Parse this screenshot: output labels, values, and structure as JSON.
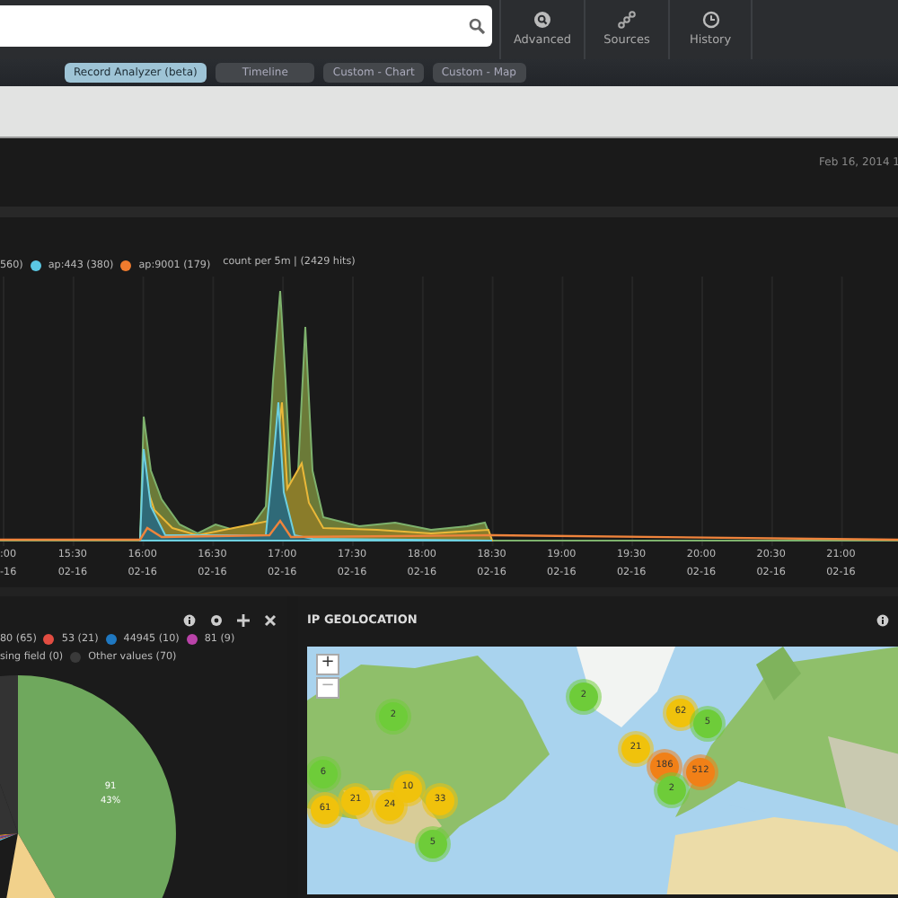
{
  "nav_buttons": [
    {
      "label": "Advanced",
      "kind": "search"
    },
    {
      "label": "Sources",
      "kind": "nodes"
    },
    {
      "label": "History",
      "kind": "clock"
    }
  ],
  "tabs": [
    {
      "label": "Record Analyzer (beta)",
      "selected": true
    },
    {
      "label": "Timeline",
      "selected": false
    },
    {
      "label": "Custom - Chart",
      "selected": false
    },
    {
      "label": "Custom - Map",
      "selected": false
    }
  ],
  "header": {
    "date": "Feb 16, 2014 1"
  },
  "histogram": {
    "legend": [
      {
        "label": "560)"
      },
      {
        "label": "ap:443 (380)",
        "color": "#5bc8e4"
      },
      {
        "label": "ap:9001 (179)",
        "color": "#ef7b2e"
      }
    ],
    "summary": "count per 5m | (2429 hits)",
    "x_labels": [
      {
        "time": ":00",
        "date": "-16"
      },
      {
        "time": "15:30",
        "date": "02-16"
      },
      {
        "time": "16:00",
        "date": "02-16"
      },
      {
        "time": "16:30",
        "date": "02-16"
      },
      {
        "time": "17:00",
        "date": "02-16"
      },
      {
        "time": "17:30",
        "date": "02-16"
      },
      {
        "time": "18:00",
        "date": "02-16"
      },
      {
        "time": "18:30",
        "date": "02-16"
      },
      {
        "time": "19:00",
        "date": "02-16"
      },
      {
        "time": "19:30",
        "date": "02-16"
      },
      {
        "time": "20:00",
        "date": "02-16"
      },
      {
        "time": "20:30",
        "date": "02-16"
      },
      {
        "time": "21:00",
        "date": "02-16"
      }
    ]
  },
  "pie_panel": {
    "legend_rows": [
      [
        {
          "label": "80 (65)"
        },
        {
          "label": "53 (21)",
          "color": "#e24d42"
        },
        {
          "label": "44945 (10)",
          "color": "#1f78c1"
        },
        {
          "label": "81 (9)",
          "color": "#ba43a9"
        }
      ],
      [
        {
          "label": "sing field (0)"
        },
        {
          "label": "Other values (70)",
          "color": "#3a3a3a"
        }
      ]
    ],
    "slice_value": "91",
    "slice_percent": "43%"
  },
  "map_panel": {
    "title": "IP GEOLOCATION",
    "zoom_in": "+",
    "zoom_out": "−",
    "markers": [
      {
        "count": "2",
        "color": "#6ecc39"
      },
      {
        "count": "6",
        "color": "#6ecc39"
      },
      {
        "count": "61",
        "color": "#f0c20c"
      },
      {
        "count": "21",
        "color": "#f0c20c"
      },
      {
        "count": "24",
        "color": "#f0c20c"
      },
      {
        "count": "10",
        "color": "#f0c20c"
      },
      {
        "count": "33",
        "color": "#f0c20c"
      },
      {
        "count": "5",
        "color": "#6ecc39"
      },
      {
        "count": "2",
        "color": "#6ecc39"
      },
      {
        "count": "62",
        "color": "#f0c20c"
      },
      {
        "count": "5",
        "color": "#6ecc39"
      },
      {
        "count": "21",
        "color": "#f0c20c"
      },
      {
        "count": "186",
        "color": "#f18017"
      },
      {
        "count": "512",
        "color": "#f18017"
      },
      {
        "count": "2",
        "color": "#6ecc39"
      }
    ]
  }
}
